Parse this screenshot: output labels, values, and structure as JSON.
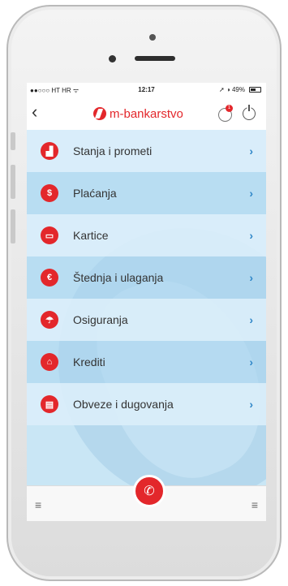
{
  "status_bar": {
    "carrier": "●●○○○ HT HR ᯤ",
    "time": "12:17",
    "battery": "➚ ◑ 49%"
  },
  "nav": {
    "back_icon": "chevron-left-icon",
    "brand": "m-bankarstvo",
    "message_badge": "1"
  },
  "menu": {
    "items": [
      {
        "label": "Stanja i prometi",
        "icon": "chart-icon"
      },
      {
        "label": "Plaćanja",
        "icon": "dollar-icon"
      },
      {
        "label": "Kartice",
        "icon": "card-icon"
      },
      {
        "label": "Štednja i ulaganja",
        "icon": "moneybag-icon"
      },
      {
        "label": "Osiguranja",
        "icon": "umbrella-icon"
      },
      {
        "label": "Krediti",
        "icon": "house-icon"
      },
      {
        "label": "Obveze i dugovanja",
        "icon": "invoice-icon"
      }
    ],
    "chevron": "›"
  },
  "tabbar": {
    "left_menu_icon": "≡",
    "right_menu_icon": "≡",
    "call_icon": "✆"
  },
  "colors": {
    "accent": "#e3272b",
    "menu_bg": "#c9e6f5",
    "chevron": "#2e86c8"
  }
}
